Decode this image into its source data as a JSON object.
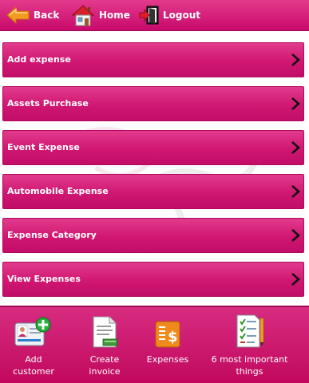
{
  "topbar": {
    "back_label": "Back",
    "home_label": "Home",
    "logout_label": "Logout"
  },
  "menu": {
    "items": [
      {
        "label": "Add expense"
      },
      {
        "label": "Assets Purchase"
      },
      {
        "label": "Event Expense"
      },
      {
        "label": "Automobile Expense"
      },
      {
        "label": "Expense Category"
      },
      {
        "label": "View Expenses"
      }
    ]
  },
  "toolbar": {
    "add_customer_line1": "Add",
    "add_customer_line2": "customer",
    "create_invoice_line1": "Create",
    "create_invoice_line2": "invoice",
    "expenses_label": "Expenses",
    "important_line1": "6 most important",
    "important_line2": "things"
  },
  "icons": {
    "back": "back-arrow-icon",
    "home": "house-icon",
    "logout": "door-exit-icon",
    "chevron": "chevron-right-icon",
    "add_customer": "contact-card-plus-icon",
    "invoice": "document-icon",
    "expenses": "dollar-document-icon",
    "important": "checklist-icon"
  },
  "colors": {
    "brand_pink": "#d01771",
    "arrow_orange": "#f39b1f",
    "plus_green": "#27b03c"
  }
}
